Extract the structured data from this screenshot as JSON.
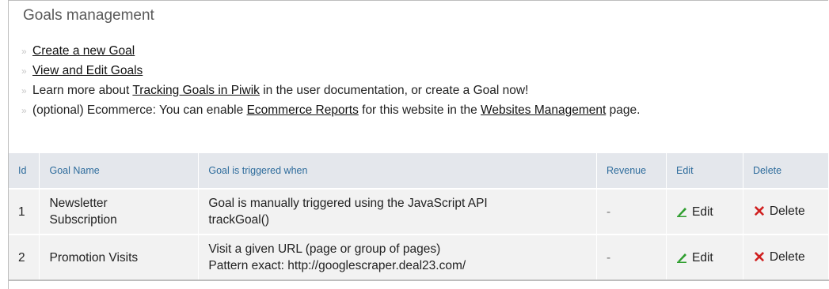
{
  "page": {
    "title": "Goals management"
  },
  "links": {
    "create_goal": "Create a new Goal",
    "view_edit": "View and Edit Goals",
    "learn_prefix": "Learn more about ",
    "learn_link": "Tracking Goals in Piwik",
    "learn_suffix": " in the user documentation, or create a Goal now!",
    "ecom_prefix": "(optional) Ecommerce: You can enable ",
    "ecom_link": "Ecommerce Reports",
    "ecom_mid": " for this website in the ",
    "ecom_link2": "Websites Management",
    "ecom_suffix": " page."
  },
  "table": {
    "headers": {
      "id": "Id",
      "name": "Goal Name",
      "trigger": "Goal is triggered when",
      "revenue": "Revenue",
      "edit": "Edit",
      "delete": "Delete"
    },
    "rows": [
      {
        "id": "1",
        "name_l1": "Newsletter",
        "name_l2": "Subscription",
        "trigger_l1": "Goal is manually triggered using the JavaScript API",
        "trigger_l2": "trackGoal()",
        "revenue": "-",
        "edit": "Edit",
        "delete": "Delete"
      },
      {
        "id": "2",
        "name_l1": "Promotion Visits",
        "name_l2": "",
        "trigger_l1": "Visit a given URL (page or group of pages)",
        "trigger_l2": "Pattern exact: http://googlescraper.deal23.com/",
        "revenue": "-",
        "edit": "Edit",
        "delete": "Delete"
      }
    ]
  },
  "icons": {
    "bullet": "»",
    "edit": "pencil-icon",
    "delete": "red-x-icon"
  },
  "colors": {
    "header_bg": "#e4e7ec",
    "header_text": "#2e6c9c",
    "row_bg": "#f2f2f2",
    "delete_red": "#d02020",
    "pencil_green": "#2f9e2f"
  }
}
